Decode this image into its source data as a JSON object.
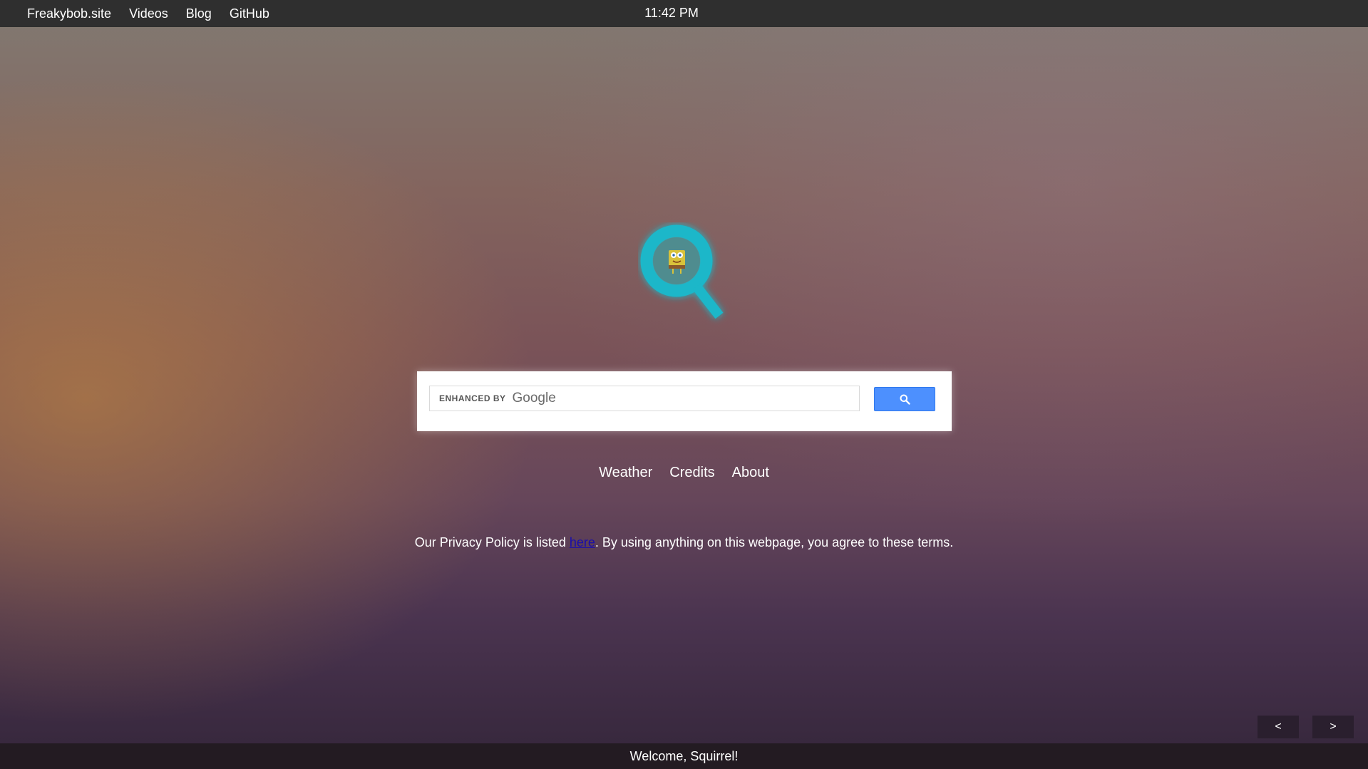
{
  "nav": {
    "items": [
      {
        "label": "Freakybob.site"
      },
      {
        "label": "Videos"
      },
      {
        "label": "Blog"
      },
      {
        "label": "GitHub"
      }
    ],
    "clock": "11:42 PM"
  },
  "search": {
    "watermark_prefix": "ENHANCED BY",
    "watermark_brand": "Google",
    "button_icon": "search-icon",
    "button_color": "#4d90fe"
  },
  "links": [
    {
      "label": "Weather"
    },
    {
      "label": "Credits"
    },
    {
      "label": "About"
    }
  ],
  "privacy": {
    "before": "Our Privacy Policy is listed ",
    "link": "here",
    "after": ". By using anything on this webpage, you agree to these terms."
  },
  "pager": {
    "prev": "<",
    "next": ">"
  },
  "footer": {
    "welcome": "Welcome, Squirrel!"
  },
  "colors": {
    "logo_accent": "#1ab7c9",
    "topbar": "#2f2f2f",
    "link_color": "#1a0dab"
  }
}
